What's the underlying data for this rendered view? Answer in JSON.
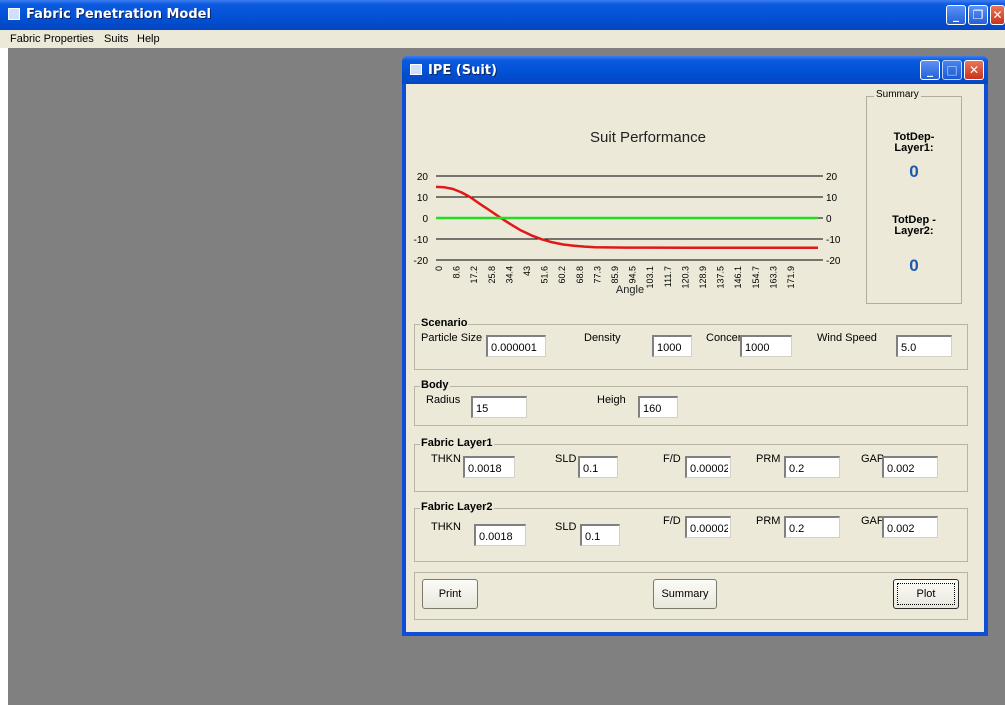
{
  "app": {
    "title": "Fabric Penetration Model",
    "menu": [
      "Fabric Properties",
      "Suits",
      "Help"
    ]
  },
  "window": {
    "title": "IPE (Suit)",
    "controls": [
      "minimize",
      "maximize",
      "close"
    ]
  },
  "chart_data": {
    "type": "line",
    "title": "Suit Performance",
    "xlabel": "Angle",
    "ylabel": "",
    "ylim": [
      -20,
      20
    ],
    "yticks": [
      20,
      10,
      0,
      -10,
      -20
    ],
    "y2ticks": [
      20,
      10,
      0,
      -10,
      -20
    ],
    "grid": "horizontal",
    "x_tick_labels": [
      "0",
      "8.6",
      "17.2",
      "25.8",
      "34.4",
      "43",
      "51.6",
      "60.2",
      "68.8",
      "77.3",
      "85.9",
      "94.5",
      "103.1",
      "111.7",
      "120.3",
      "128.9",
      "137.5",
      "146.1",
      "154.7",
      "163.3",
      "171.9"
    ],
    "x_range": [
      0,
      180
    ],
    "series": [
      {
        "color": "#e01818",
        "points": [
          [
            0,
            14.8
          ],
          [
            4,
            14.6
          ],
          [
            8,
            13.8
          ],
          [
            12,
            12.2
          ],
          [
            16,
            10
          ],
          [
            20,
            7.2
          ],
          [
            25,
            3.8
          ],
          [
            30,
            0.4
          ],
          [
            35,
            -2.9
          ],
          [
            40,
            -5.9
          ],
          [
            45,
            -8.3
          ],
          [
            50,
            -10.2
          ],
          [
            55,
            -11.6
          ],
          [
            60,
            -12.6
          ],
          [
            65,
            -13.2
          ],
          [
            70,
            -13.6
          ],
          [
            75,
            -13.9
          ],
          [
            80,
            -14.0
          ],
          [
            90,
            -14.1
          ],
          [
            100,
            -14.1
          ],
          [
            120,
            -14.15
          ],
          [
            150,
            -14.2
          ],
          [
            180,
            -14.2
          ]
        ]
      },
      {
        "color": "#22dd22",
        "points": [
          [
            0,
            0
          ],
          [
            180,
            0
          ]
        ]
      }
    ]
  },
  "summary": {
    "legend": "Summary",
    "label1": "TotDep-\nLayer1:",
    "label1_a": "TotDep-",
    "label1_b": "Layer1:",
    "value1": "0",
    "label2_a": "TotDep -",
    "label2_b": "Layer2:",
    "value2": "0"
  },
  "scenario": {
    "title": "Scenario",
    "particle_size_label": "Particle Size",
    "particle_size": "0.000001",
    "density_label": "Density",
    "density": "1000",
    "concen_label": "Concen",
    "concen": "1000",
    "wind_speed_label": "Wind Speed",
    "wind_speed": "5.0"
  },
  "body": {
    "title": "Body",
    "radius_label": "Radius",
    "radius": "15",
    "heigh_label": "Heigh",
    "heigh": "160"
  },
  "layer1": {
    "title": "Fabric Layer1",
    "thkn_label": "THKN",
    "thkn": "0.0018",
    "sld_label": "SLD",
    "sld": "0.1",
    "fd_label": "F/D",
    "fd": "0.00002",
    "prm_label": "PRM",
    "prm": "0.2",
    "gap_label": "GAP",
    "gap": "0.002"
  },
  "layer2": {
    "title": "Fabric Layer2",
    "thkn_label": "THKN",
    "thkn": "0.0018",
    "sld_label": "SLD",
    "sld": "0.1",
    "fd_label": "F/D",
    "fd": "0.00002",
    "prm_label": "PRM",
    "prm": "0.2",
    "gap_label": "GAP",
    "gap": "0.002"
  },
  "buttons": {
    "print": "Print",
    "summary": "Summary",
    "plot": "Plot"
  },
  "colors": {
    "titlebar": "#0250d4",
    "workspace": "#808080",
    "dialog_bg": "#ece9d8",
    "summary_value": "#1a5ab0"
  }
}
